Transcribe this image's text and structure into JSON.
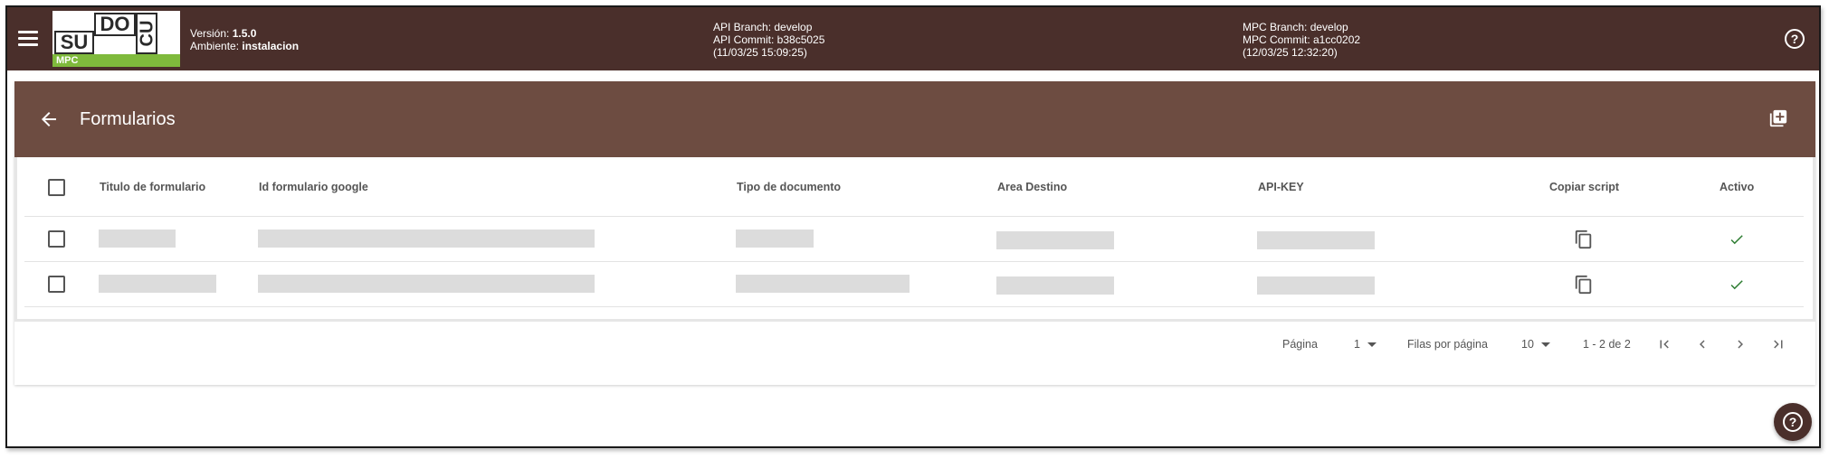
{
  "topbar": {
    "logo": {
      "su": "SU",
      "do": "DO",
      "cu": "CU",
      "mpc": "MPC"
    },
    "version_label": "Versión:",
    "version_value": "1.5.0",
    "env_label": "Ambiente:",
    "env_value": "instalacion",
    "api_branch": "API Branch: develop",
    "api_commit": "API Commit: b38c5025",
    "api_date": "(11/03/25 15:09:25)",
    "mpc_branch": "MPC Branch: develop",
    "mpc_commit": "MPC Commit: a1cc0202",
    "mpc_date": "(12/03/25 12:32:20)",
    "help_glyph": "?"
  },
  "card": {
    "title": "Formularios"
  },
  "table": {
    "columns": [
      "Titulo de formulario",
      "Id formulario google",
      "Tipo de documento",
      "Area Destino",
      "API-KEY",
      "Copiar script",
      "Activo"
    ],
    "rows": [
      {
        "selected": false,
        "titulo": "",
        "id_google": "",
        "tipo": "",
        "area": "",
        "api_key": "",
        "activo": true
      },
      {
        "selected": false,
        "titulo": "",
        "id_google": "",
        "tipo": "",
        "area": "",
        "api_key": "",
        "activo": true
      }
    ]
  },
  "pagination": {
    "page_label": "Página",
    "page_value": "1",
    "rows_label": "Filas por página",
    "rows_value": "10",
    "range": "1 - 2 de 2"
  },
  "icons": {
    "menu": "menu-icon",
    "back": "arrow-left-icon",
    "add": "library-add-icon",
    "copy": "copy-icon",
    "check": "check-icon",
    "help": "help-circle-icon",
    "first": "first-page-icon",
    "prev": "chevron-left-icon",
    "next": "chevron-right-icon",
    "last": "last-page-icon"
  },
  "colors": {
    "topbar": "#4a2f2b",
    "header": "#6d4c41",
    "accent_green": "#7fba3c",
    "check_green": "#2e7d32",
    "placeholder": "#dcdcdc"
  }
}
